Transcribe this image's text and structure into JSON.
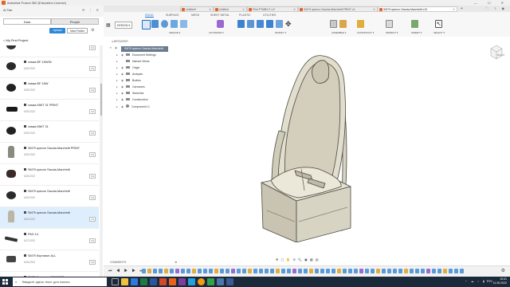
{
  "window": {
    "title": "Autodesk Fusion 360 (Education License)",
    "controls": "— ☐ ✕"
  },
  "leftpanel": {
    "team": "Al Tarr",
    "icons": "⟳ ⋮ ✕",
    "tabs": [
      "Data",
      "People"
    ],
    "upload": "Upload",
    "new_folder": "New Folder",
    "project": "My First Project",
    "items": [
      {
        "name": "sloop",
        "date": "",
        "ver": "V1"
      },
      {
        "name": "хомка BF-16W36",
        "date": "6/20/2022",
        "ver": "V1"
      },
      {
        "name": "хомка BF-16W",
        "date": "6/20/2022",
        "ver": "V1"
      },
      {
        "name": "хомка MWT 31 PRINT",
        "date": "6/20/2022",
        "ver": "V1"
      },
      {
        "name": "хомка MWT 31",
        "date": "6/20/2022",
        "ver": "V1"
      },
      {
        "name": "SM79 кресло Savoia-Marchetti PRINT",
        "date": "6/20/2022",
        "ver": "V1"
      },
      {
        "name": "SM79 кресло Savoia-Marchetti",
        "date": "6/20/2022",
        "ver": "V1"
      },
      {
        "name": "SM79 кресло Savoia-Marchetti",
        "date": "6/20/2022",
        "ver": "V1"
      },
      {
        "name": "SM79 кресло Savoia-Marchetti",
        "date": "6/20/2022",
        "ver": "V1"
      },
      {
        "name": "PAG 14",
        "date": "6/17/2022",
        "ver": "V1"
      },
      {
        "name": "SM79 бортовое ALL",
        "date": "6/16/2022",
        "ver": "V1"
      },
      {
        "name": "SM79 бортовое COCKPIT",
        "date": "",
        "ver": "V1"
      }
    ]
  },
  "tabs": [
    {
      "label": "Untitled*",
      "active": false
    },
    {
      "label": "Untitled",
      "active": false
    },
    {
      "label": "Pilot PTMB2 2 v1*",
      "active": false
    },
    {
      "label": "SM79 кресло Savoia-Marchetti PRINT v1",
      "active": false
    },
    {
      "label": "SM79 кресло Savoia-Marchetti v10",
      "active": true
    }
  ],
  "toolbar": {
    "workspace_tabs": [
      "SOLID",
      "SURFACE",
      "MESH",
      "SHEET METAL",
      "PLASTIC",
      "UTILITIES"
    ],
    "design": "DESIGN ▾",
    "groups": [
      "CREATE ▾",
      "AUTOMATE ▾",
      "MODIFY ▾",
      "ASSEMBLE ▾",
      "CONSTRUCT ▾",
      "INSPECT ▾",
      "INSERT ▾",
      "SELECT ▾"
    ]
  },
  "browser": {
    "header": "BROWSER",
    "root": "SM79 кресло Savoia-Marchetti...",
    "nodes": [
      "Document Settings",
      "Named Views",
      "Origin",
      "Analysis",
      "Bodies",
      "Canvases",
      "Sketches",
      "Construction",
      "Component1:1"
    ]
  },
  "canvas": {
    "comments": "COMMENTS",
    "nav": "✥ ▢ ✋ ⊕ 🔍 ▣ ▦ ▤"
  },
  "timeline": {
    "controls": "⏮ ◀ ▶ ▶ ⏭"
  },
  "taskbar": {
    "search_placeholder": "Введите здесь текст для поиска",
    "time": "10:01",
    "date": "11.06.2022",
    "lang": "РУС",
    "tray": "^ ☁ ♪ ▮"
  }
}
